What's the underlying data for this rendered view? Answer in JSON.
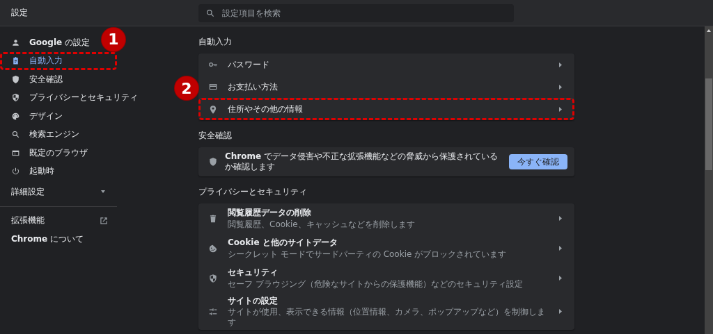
{
  "header": {
    "title": "設定",
    "search": {
      "placeholder": "設定項目を検索"
    }
  },
  "sidebar": {
    "items": [
      {
        "label": "**Google** の設定",
        "selected": false,
        "highlighted": false
      },
      {
        "label": "自動入力",
        "selected": true,
        "highlighted": true,
        "callout": "1"
      },
      {
        "label": "安全確認",
        "selected": false,
        "highlighted": false
      },
      {
        "label": "プライバシーとセキュリティ",
        "selected": false,
        "highlighted": false
      },
      {
        "label": "デザイン",
        "selected": false,
        "highlighted": false
      },
      {
        "label": "検索エンジン",
        "selected": false,
        "highlighted": false
      },
      {
        "label": "既定のブラウザ",
        "selected": false,
        "highlighted": false
      },
      {
        "label": "起動時",
        "selected": false,
        "highlighted": false
      }
    ],
    "advanced": {
      "label": "詳細設定",
      "expanded": false
    },
    "links": [
      {
        "label": "拡張機能",
        "external": true
      },
      {
        "label": "**Chrome** について",
        "external": false
      }
    ]
  },
  "main": {
    "sections": [
      {
        "title": "自動入力",
        "kind": "links",
        "rows": [
          {
            "label": "パスワード",
            "highlighted": false
          },
          {
            "label": "お支払い方法",
            "highlighted": false
          },
          {
            "label": "住所やその他の情報",
            "highlighted": true,
            "callout": "2"
          }
        ]
      },
      {
        "title": "安全確認",
        "kind": "check",
        "text": "**Chrome** でデータ侵害や不正な拡張機能などの脅威から保護されているか確認します",
        "button": "今すぐ確認"
      },
      {
        "title": "プライバシーとセキュリティ",
        "kind": "links",
        "rows": [
          {
            "label": "閲覧履歴データの削除",
            "description": "閲覧履歴、Cookie、キャッシュなどを削除します",
            "highlighted": false
          },
          {
            "label": "Cookie と他のサイトデータ",
            "description": "シークレット モードでサードパーティの Cookie がブロックされています",
            "highlighted": false
          },
          {
            "label": "セキュリティ",
            "description": "セーフ ブラウジング（危険なサイトからの保護機能）などのセキュリティ設定",
            "highlighted": false
          },
          {
            "label": "サイトの設定",
            "description": "サイトが使用、表示できる情報（位置情報、カメラ、ポップアップなど）を制御します",
            "highlighted": false
          }
        ]
      }
    ]
  }
}
